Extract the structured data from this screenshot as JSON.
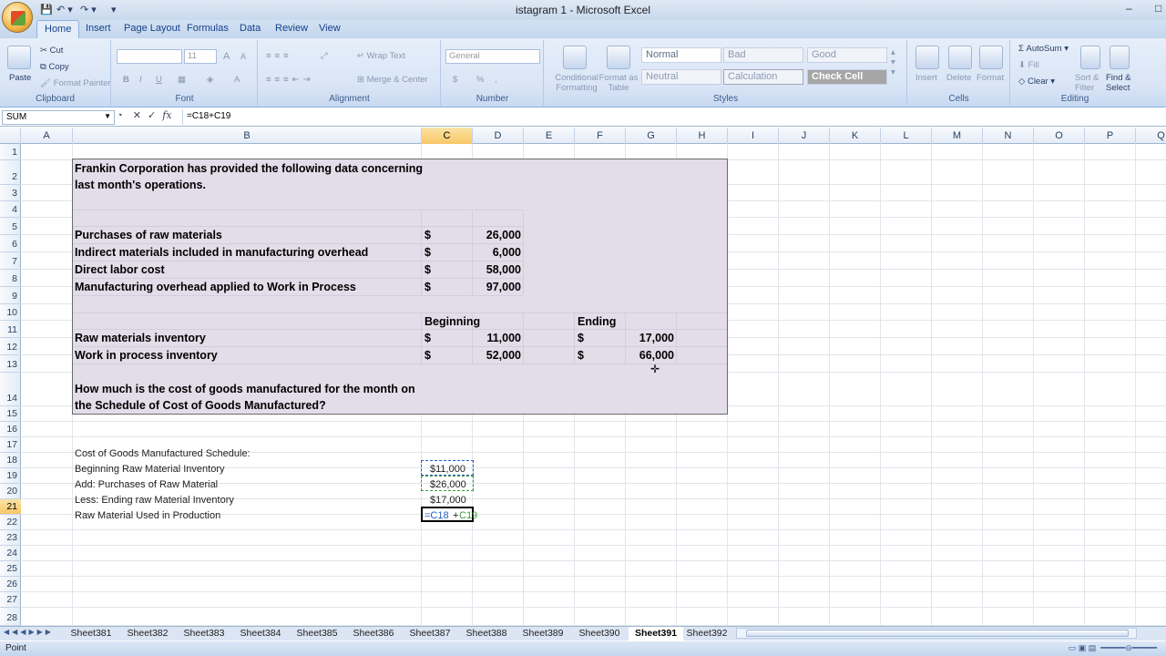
{
  "window": {
    "title": "istagram 1 - Microsoft Excel",
    "minimize": "–",
    "maximize": "□"
  },
  "qat": {
    "save_icon": "save-icon",
    "undo": "↶ ▾",
    "redo": "↷ ▾",
    "more": "▾"
  },
  "ribbon_tabs": [
    "Home",
    "Insert",
    "Page Layout",
    "Formulas",
    "Data",
    "Review",
    "View"
  ],
  "ribbon": {
    "clipboard": {
      "label": "Clipboard",
      "paste": "Paste",
      "cut": "Cut",
      "copy": "Copy",
      "format_painter": "Format Painter"
    },
    "font": {
      "label": "Font",
      "size": "11",
      "bold": "B",
      "italic": "I",
      "underline": "U",
      "grow": "A",
      "shrink": "A"
    },
    "alignment": {
      "label": "Alignment",
      "wrap": "Wrap Text",
      "merge": "Merge & Center"
    },
    "number": {
      "label": "Number",
      "format": "General",
      "currency": "$",
      "percent": "%",
      "comma": ","
    },
    "styles": {
      "label": "Styles",
      "conditional": "Conditional Formatting",
      "format_table": "Format as Table",
      "normal": "Normal",
      "bad": "Bad",
      "good": "Good",
      "neutral": "Neutral",
      "calculation": "Calculation",
      "check_cell": "Check Cell"
    },
    "cells": {
      "label": "Cells",
      "insert": "Insert",
      "delete": "Delete",
      "format": "Format"
    },
    "editing": {
      "label": "Editing",
      "autosum": "AutoSum",
      "fill": "Fill",
      "clear": "Clear",
      "sort_filter": "Sort & Filter",
      "find_select": "Find & Select"
    }
  },
  "formula_bar": {
    "name_box": "SUM",
    "cancel": "✕",
    "enter": "✓",
    "fx": "fx",
    "formula": "=C18+C19"
  },
  "columns": [
    "A",
    "B",
    "C",
    "D",
    "E",
    "F",
    "G",
    "H",
    "I",
    "J",
    "K",
    "L",
    "M",
    "N",
    "O",
    "P",
    "Q"
  ],
  "rows": [
    "1",
    "2",
    "3",
    "4",
    "5",
    "6",
    "7",
    "8",
    "9",
    "10",
    "11",
    "12",
    "13",
    "14",
    "15",
    "16",
    "17",
    "18",
    "19",
    "20",
    "21",
    "22",
    "23",
    "24",
    "25",
    "26",
    "27",
    "28"
  ],
  "sheet": {
    "intro_line1": "Frankin Corporation has provided the following data concerning",
    "intro_line2": "last month's operations.",
    "items": [
      {
        "label": "Purchases of raw materials",
        "cur": "$",
        "value": "26,000"
      },
      {
        "label": "Indirect materials included in manufacturing overhead",
        "cur": "$",
        "value": "6,000"
      },
      {
        "label": "Direct labor cost",
        "cur": "$",
        "value": "58,000"
      },
      {
        "label": "Manufacturing overhead applied to Work in Process",
        "cur": "$",
        "value": "97,000"
      }
    ],
    "beginning": "Beginning",
    "ending": "Ending",
    "inventory": [
      {
        "label": "Raw materials inventory",
        "cur1": "$",
        "begin": "11,000",
        "cur2": "$",
        "end": "17,000"
      },
      {
        "label": "Work in process inventory",
        "cur1": "$",
        "begin": "52,000",
        "cur2": "$",
        "end": "66,000"
      }
    ],
    "question_line1": "How much is the cost of goods manufactured for the month on",
    "question_line2": "the Schedule of Cost of Goods Manufactured?",
    "schedule": {
      "title": "Cost of Goods Manufactured Schedule:",
      "rows": [
        {
          "label": "Beginning Raw Material Inventory",
          "value": "$11,000"
        },
        {
          "label": "Add: Purchases of Raw Material",
          "value": "$26,000"
        },
        {
          "label": "Less: Ending raw Material Inventory",
          "value": "$17,000"
        },
        {
          "label": "Raw Material Used in Production",
          "formula_a": "=C18",
          "formula_plus": "+",
          "formula_b": "C19"
        }
      ]
    }
  },
  "sheet_tabs": [
    "Sheet381",
    "Sheet382",
    "Sheet383",
    "Sheet384",
    "Sheet385",
    "Sheet386",
    "Sheet387",
    "Sheet388",
    "Sheet389",
    "Sheet390",
    "Sheet391",
    "Sheet392"
  ],
  "active_sheet": "Sheet391",
  "status": {
    "mode": "Point"
  }
}
